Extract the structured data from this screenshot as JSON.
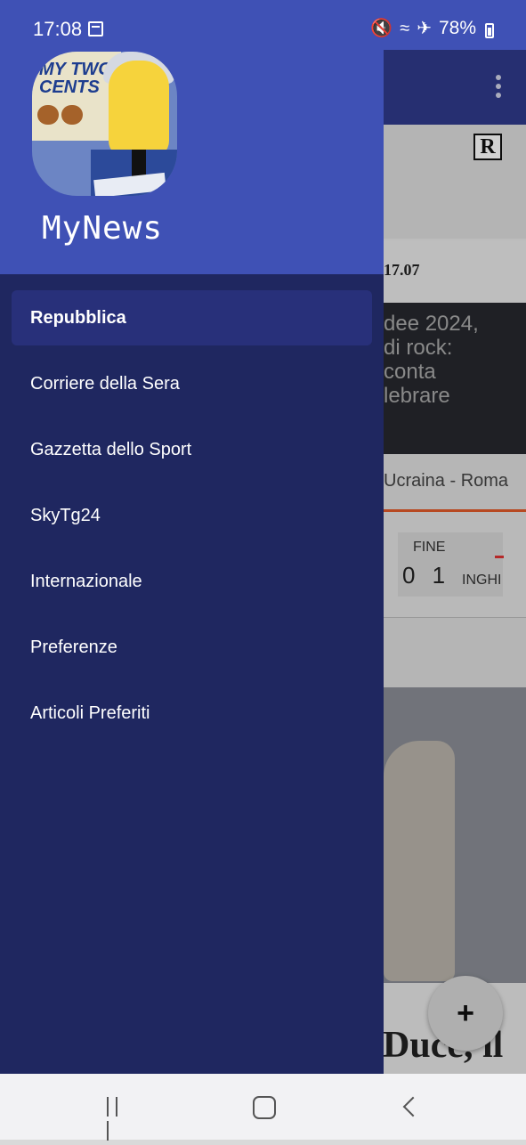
{
  "status_bar": {
    "time": "17:08",
    "battery": "78%",
    "icons": [
      "calendar-icon",
      "mute-icon",
      "wifi-icon",
      "airplane-icon",
      "battery-icon"
    ]
  },
  "drawer": {
    "app_title": "MyNews",
    "avatar_sign_text": "MY TWO CENTS",
    "menu": [
      {
        "label": "Repubblica",
        "active": true
      },
      {
        "label": "Corriere della Sera",
        "active": false
      },
      {
        "label": "Gazzetta dello Sport",
        "active": false
      },
      {
        "label": "SkyTg24",
        "active": false
      },
      {
        "label": "Internazionale",
        "active": false
      },
      {
        "label": "Preferenze",
        "active": false
      },
      {
        "label": "Articoli Preferiti",
        "active": false
      }
    ]
  },
  "background_content": {
    "logo_letter": "R",
    "date_fragment": "17.07",
    "headline_fragment": "dee 2024,\n di rock:\nconta\nlebrare",
    "ticker_fragment": "Ucraina - Roma",
    "score_status": "FINE",
    "score": "0 1",
    "team_fragment": "INGHI",
    "bottom_headline_fragment": "Duce, il",
    "fab_label": "+"
  },
  "colors": {
    "primary": "#3f51b5",
    "drawer_bg": "#1f2760",
    "active_item_bg": "#28307a"
  }
}
